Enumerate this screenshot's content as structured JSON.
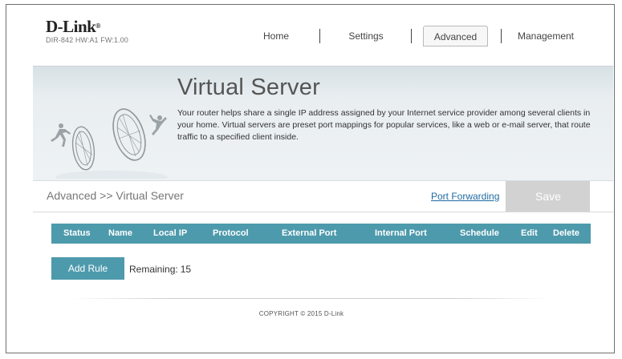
{
  "brand": {
    "name": "D-Link",
    "trademark": "®",
    "model_info": "DIR-842   HW:A1   FW:1.00"
  },
  "nav": {
    "items": [
      {
        "label": "Home"
      },
      {
        "label": "Settings"
      },
      {
        "label": "Advanced",
        "active": true
      },
      {
        "label": "Management"
      }
    ]
  },
  "banner": {
    "title": "Virtual Server",
    "description": "Your router helps share a single IP address assigned by your Internet service provider among several clients in your home. Virtual servers are preset port mappings for popular services, like a web or e-mail server, that route traffic to a specified client inside."
  },
  "subbar": {
    "breadcrumb": "Advanced >> Virtual Server",
    "port_forwarding_link": "Port Forwarding",
    "save_label": "Save"
  },
  "table": {
    "columns": [
      "Status",
      "Name",
      "Local IP",
      "Protocol",
      "External Port",
      "Internal Port",
      "Schedule",
      "Edit",
      "Delete"
    ],
    "rows": []
  },
  "rules": {
    "add_label": "Add Rule",
    "remaining_label": "Remaining:",
    "remaining_count": "15"
  },
  "footer": {
    "copyright": "COPYRIGHT © 2015 D-Link"
  },
  "colors": {
    "accent": "#4d9aac",
    "link": "#1f6aa3",
    "save_disabled": "#d2d2d2"
  }
}
